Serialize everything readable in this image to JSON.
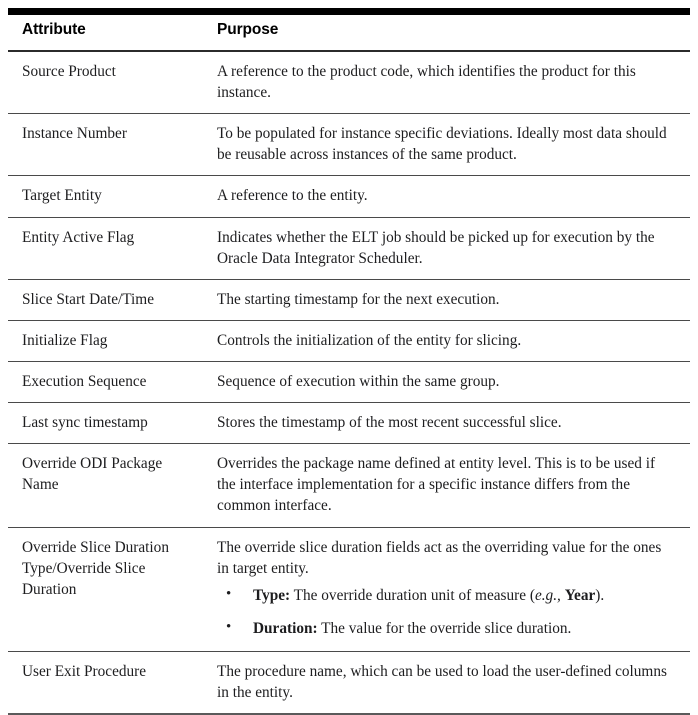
{
  "table": {
    "headers": {
      "attribute": "Attribute",
      "purpose": "Purpose"
    },
    "rows": [
      {
        "attribute": "Source Product",
        "purpose": "A reference to the product code, which identifies the product for this instance."
      },
      {
        "attribute": "Instance Number",
        "purpose": "To be populated for instance specific deviations. Ideally most data should be reusable across instances of the same product."
      },
      {
        "attribute": "Target Entity",
        "purpose": "A reference to the entity."
      },
      {
        "attribute": "Entity Active Flag",
        "purpose": "Indicates whether the ELT job should be picked up for execution by the Oracle Data Integrator Scheduler."
      },
      {
        "attribute": "Slice Start Date/Time",
        "purpose": "The starting timestamp for the next execution."
      },
      {
        "attribute": "Initialize Flag",
        "purpose": "Controls the initialization of the entity for slicing."
      },
      {
        "attribute": "Execution Sequence",
        "purpose": "Sequence of execution within the same group."
      },
      {
        "attribute": "Last sync timestamp",
        "purpose": "Stores the timestamp of the most recent successful slice."
      },
      {
        "attribute": "Override ODI Package Name",
        "purpose": "Overrides the package name defined at entity level. This is to be used if the interface implementation for a specific instance differs from the common interface."
      },
      {
        "attribute": "Override Slice Duration Type/Override Slice Duration",
        "purpose": "The override slice duration fields act as the overriding value for the ones in target entity.",
        "bullets": [
          {
            "label": "Type:",
            "text_before": "The override duration unit of measure (",
            "italic": "e.g.,",
            "bold": "Year",
            "text_after": ")."
          },
          {
            "label": "Duration:",
            "text_before": "The value for the override slice duration.",
            "italic": "",
            "bold": "",
            "text_after": ""
          }
        ]
      },
      {
        "attribute": "User Exit Procedure",
        "purpose": "The procedure name, which can be used to load the user-defined columns in the entity."
      }
    ]
  }
}
